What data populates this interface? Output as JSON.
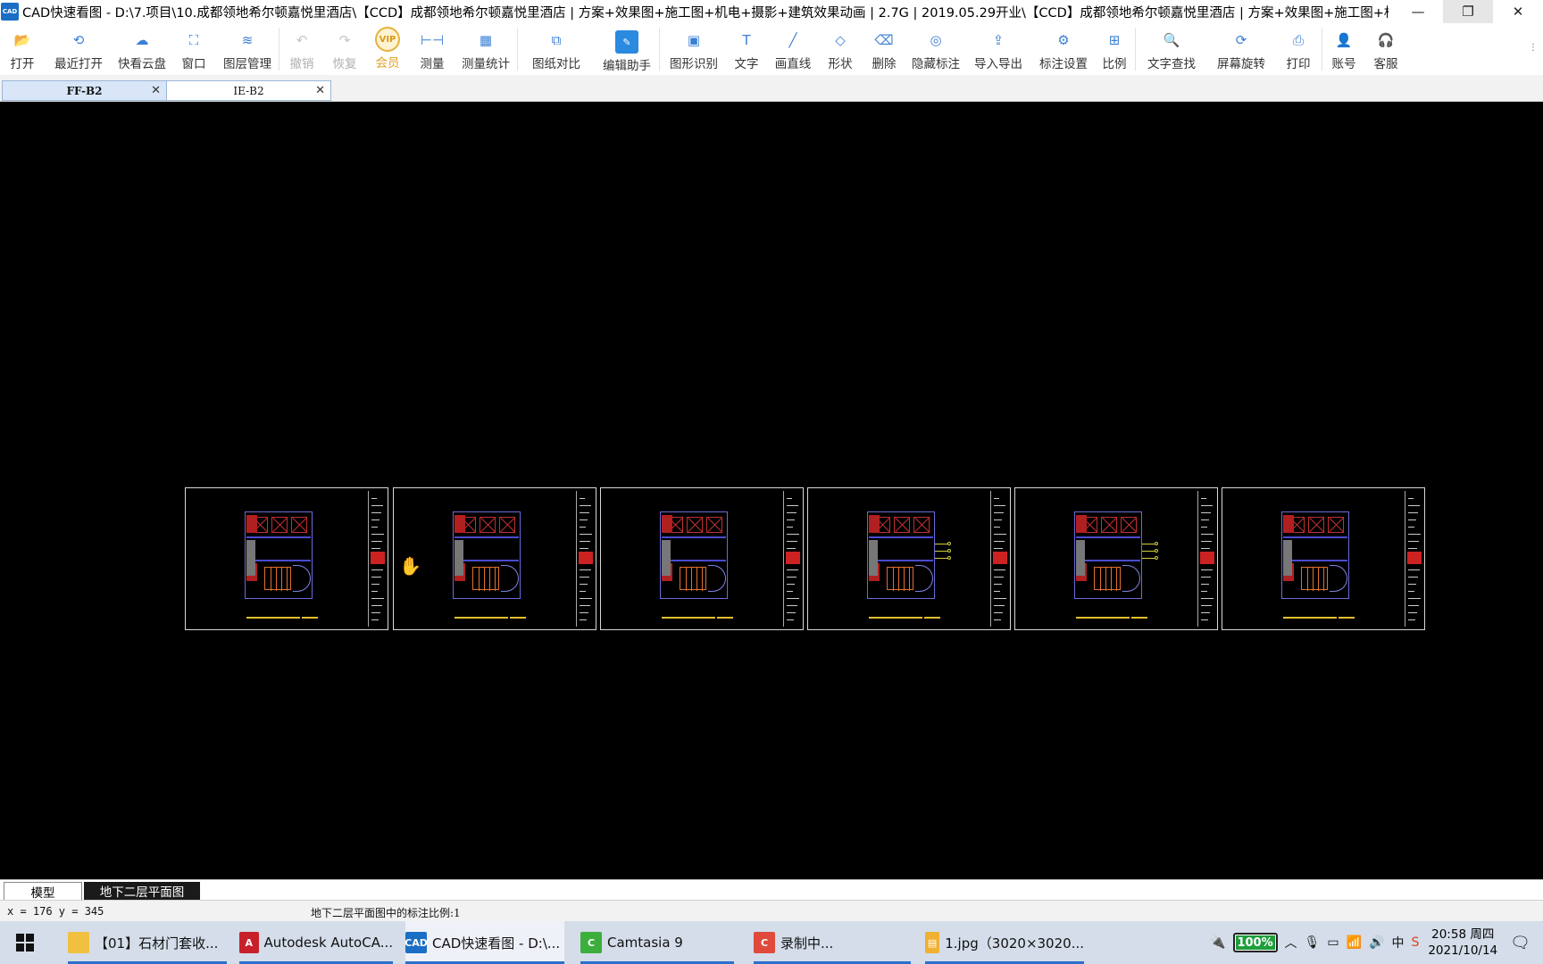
{
  "window": {
    "icon": "CAD",
    "title": "CAD快速看图 - D:\\7.项目\\10.成都领地希尔顿嘉悦里酒店\\【CCD】成都领地希尔顿嘉悦里酒店 | 方案+效果图+施工图+机电+摄影+建筑效果动画 | 2.7G | 2019.05.29开业\\【CCD】成都领地希尔顿嘉悦里酒店 | 方案+效果图+施工图+机电...",
    "minimize": "—",
    "restore": "❐",
    "close": "✕"
  },
  "toolbar": {
    "items": [
      {
        "label": "打开",
        "icon": "folder-open-icon",
        "glyph": "📂"
      },
      {
        "label": "最近打开",
        "icon": "history-icon",
        "glyph": "⟲"
      },
      {
        "label": "快看云盘",
        "icon": "cloud-icon",
        "glyph": "☁"
      },
      {
        "label": "窗口",
        "icon": "window-icon",
        "glyph": "⛶"
      },
      {
        "label": "图层管理",
        "icon": "layers-icon",
        "glyph": "≋"
      },
      {
        "label": "撤销",
        "icon": "undo-icon",
        "glyph": "↶"
      },
      {
        "label": "恢复",
        "icon": "redo-icon",
        "glyph": "↷"
      },
      {
        "label": "会员",
        "icon": "vip-icon",
        "glyph": "VIP"
      },
      {
        "label": "测量",
        "icon": "measure-icon",
        "glyph": "⊢⊣"
      },
      {
        "label": "测量统计",
        "icon": "measure-stats-icon",
        "glyph": "▦"
      },
      {
        "label": "图纸对比",
        "icon": "compare-icon",
        "glyph": "⧉"
      },
      {
        "label": "编辑助手",
        "icon": "edit-helper-icon",
        "glyph": "✎"
      },
      {
        "label": "图形识别",
        "icon": "shape-recognize-icon",
        "glyph": "▣"
      },
      {
        "label": "文字",
        "icon": "text-icon",
        "glyph": "T"
      },
      {
        "label": "画直线",
        "icon": "line-icon",
        "glyph": "╱"
      },
      {
        "label": "形状",
        "icon": "shape-icon",
        "glyph": "◇"
      },
      {
        "label": "删除",
        "icon": "eraser-icon",
        "glyph": "⌫"
      },
      {
        "label": "隐藏标注",
        "icon": "hide-annotation-icon",
        "glyph": "◎"
      },
      {
        "label": "导入导出",
        "icon": "import-export-icon",
        "glyph": "⇪"
      },
      {
        "label": "标注设置",
        "icon": "annotation-settings-icon",
        "glyph": "⚙"
      },
      {
        "label": "比例",
        "icon": "scale-icon",
        "glyph": "⊞"
      },
      {
        "label": "文字查找",
        "icon": "text-search-icon",
        "glyph": "🔍"
      },
      {
        "label": "屏幕旋转",
        "icon": "rotate-screen-icon",
        "glyph": "⟳"
      },
      {
        "label": "打印",
        "icon": "print-icon",
        "glyph": "⎙"
      },
      {
        "label": "账号",
        "icon": "account-icon",
        "glyph": "👤"
      },
      {
        "label": "客服",
        "icon": "headset-icon",
        "glyph": "🎧"
      }
    ],
    "more": "⋮"
  },
  "doc_tabs": [
    {
      "label": "FF-B2",
      "close": "✕"
    },
    {
      "label": "IE-B2",
      "close": "✕"
    }
  ],
  "layout_tabs": {
    "model": "模型",
    "sheet": "地下二层平面图"
  },
  "status": {
    "coords": "x = 176  y = 345",
    "message": "地下二层平面图中的标注比例:1"
  },
  "taskbar": {
    "tasks": [
      {
        "label": "【01】石材门套收...",
        "icon": "folder-icon"
      },
      {
        "label": "Autodesk AutoCA...",
        "icon": "autocad-icon"
      },
      {
        "label": "CAD快速看图 - D:\\...",
        "icon": "cad-viewer-icon"
      },
      {
        "label": "Camtasia 9",
        "icon": "camtasia-icon"
      },
      {
        "label": "录制中...",
        "icon": "recorder-icon"
      },
      {
        "label": "1.jpg（3020×3020...",
        "icon": "image-viewer-icon"
      }
    ],
    "battery": "100%",
    "battery_level": 1.0,
    "ime": "中",
    "time": "20:58 周四",
    "date": "2021/10/14"
  }
}
